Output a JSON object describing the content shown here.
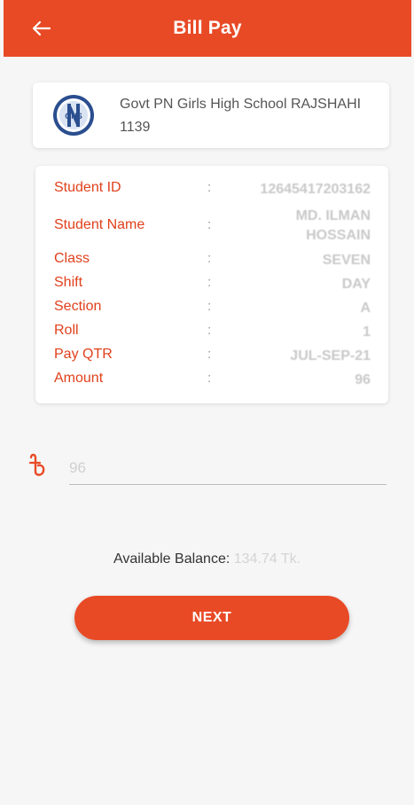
{
  "appbar": {
    "title": "Bill Pay",
    "back_icon": "arrow-left-icon",
    "color": "#e84a26"
  },
  "school": {
    "logo_icon": "school-logo-icon",
    "logo_text": "GNS",
    "name": "Govt PN Girls High School RAJSHAHI",
    "code": "1139"
  },
  "student_info": {
    "rows": [
      {
        "label": "Student ID",
        "colon": ":",
        "value": "12645417203162"
      },
      {
        "label": "Student Name",
        "colon": ":",
        "value_line1": "MD. ILMAN",
        "value_line2": "HOSSAIN"
      },
      {
        "label": "Class",
        "colon": ":",
        "value": "SEVEN"
      },
      {
        "label": "Shift",
        "colon": ":",
        "value": "DAY"
      },
      {
        "label": "Section",
        "colon": ":",
        "value": "A"
      },
      {
        "label": "Roll",
        "colon": ":",
        "value": "1"
      },
      {
        "label": "Pay QTR",
        "colon": ":",
        "value": "JUL-SEP-21"
      },
      {
        "label": "Amount",
        "colon": ":",
        "value": "96"
      }
    ],
    "label_color": "#e0401b"
  },
  "amount_input": {
    "currency_icon": "taka-icon",
    "value": "96"
  },
  "balance": {
    "label": "Available Balance:",
    "value": "134.74 Tk."
  },
  "next_button": {
    "label": "NEXT"
  }
}
